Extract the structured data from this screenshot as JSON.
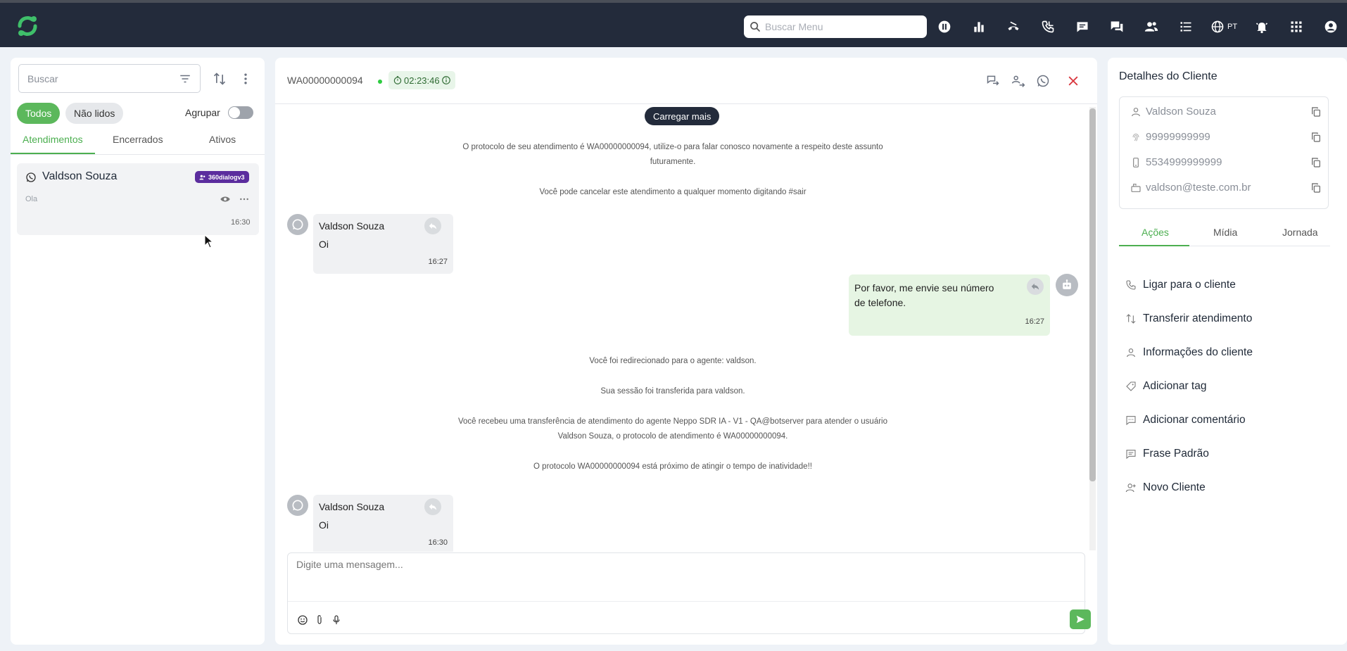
{
  "topbar": {
    "search_placeholder": "Buscar Menu",
    "language": "PT"
  },
  "left": {
    "search_placeholder": "Buscar",
    "filters": {
      "all": "Todos",
      "unread": "Não lidos"
    },
    "group_label": "Agrupar",
    "tabs": [
      "Atendimentos",
      "Encerrados",
      "Ativos"
    ],
    "conversation": {
      "name": "Valdson Souza",
      "badge": "360dialogv3",
      "preview": "Ola",
      "time": "16:30"
    }
  },
  "center": {
    "protocol": "WA00000000094",
    "timer": "02:23:46",
    "load_more": "Carregar mais",
    "system": {
      "s1": "O protocolo de seu atendimento é WA00000000094, utilize-o para falar conosco novamente a respeito deste assunto futuramente.",
      "s2": "Você pode cancelar este atendimento a qualquer momento digitando #sair",
      "s3": "Você foi redirecionado para o agente: valdson.",
      "s4": "Sua sessão foi transferida para valdson.",
      "s5": "Você recebeu uma transferência de atendimento do agente Neppo SDR IA - V1 - QA@botserver para atender o usuário Valdson Souza, o protocolo de atendimento é WA00000000094.",
      "s6": "O protocolo WA00000000094 está próximo de atingir o tempo de inatividade!!"
    },
    "messages": {
      "m1": {
        "name": "Valdson Souza",
        "text": "Oi",
        "time": "16:27"
      },
      "m2": {
        "text": "Por favor, me envie seu número de telefone.",
        "time": "16:27"
      },
      "m3": {
        "name": "Valdson Souza",
        "text": "Oi",
        "time": "16:30"
      }
    },
    "composer_placeholder": "Digite uma mensagem..."
  },
  "right": {
    "title": "Detalhes do Cliente",
    "details": {
      "name": "Valdson Souza",
      "document": "99999999999",
      "phone": "5534999999999",
      "email": "valdson@teste.com.br"
    },
    "tabs": [
      "Ações",
      "Mídia",
      "Jornada"
    ],
    "actions": [
      "Ligar para o cliente",
      "Transferir atendimento",
      "Informações do cliente",
      "Adicionar tag",
      "Adicionar comentário",
      "Frase Padrão",
      "Novo Cliente"
    ]
  },
  "colors": {
    "topbar": "#232b3b",
    "accent_green": "#5cb85c",
    "badge_purple": "#5b2d9e",
    "close_red": "#d9363e"
  }
}
